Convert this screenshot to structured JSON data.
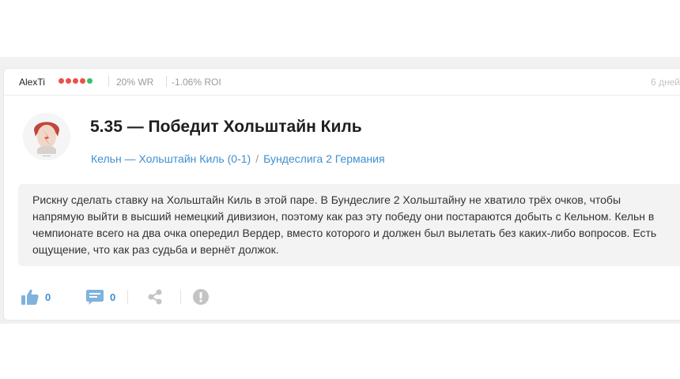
{
  "post": {
    "username": "AlexTi",
    "form_dots": [
      "#e9524a",
      "#e9524a",
      "#e9524a",
      "#e9524a",
      "#3bbf61"
    ],
    "win_rate": "20% WR",
    "roi": "-1.06% ROI",
    "date": "6 дней",
    "title": "5.35 — Победит Хольштайн Киль",
    "match_link": "Кельн — Хольштайн Киль (0-1)",
    "separator": "/",
    "league_link": "Бундеслига 2 Германия",
    "body": "Рискну сделать ставку на Хольштайн Киль в этой паре. В Бундеслиге 2 Хольштайну не хватило трёх очков, чтобы напрямую выйти в высший немецкий дивизион, поэтому как раз эту победу они постараются добыть с Кельном. Кельн в чемпионате всего на два очка опередил Вердер, вместо которого и должен был вылетать без каких-либо вопросов. Есть ощущение, что как раз судьба и вернёт должок.",
    "likes": "0",
    "comments": "0"
  },
  "colors": {
    "accent": "#3f8fd0",
    "icon_gray": "#c4c4c4",
    "loss_dot": "#e9524a",
    "win_dot": "#3bbf61"
  }
}
